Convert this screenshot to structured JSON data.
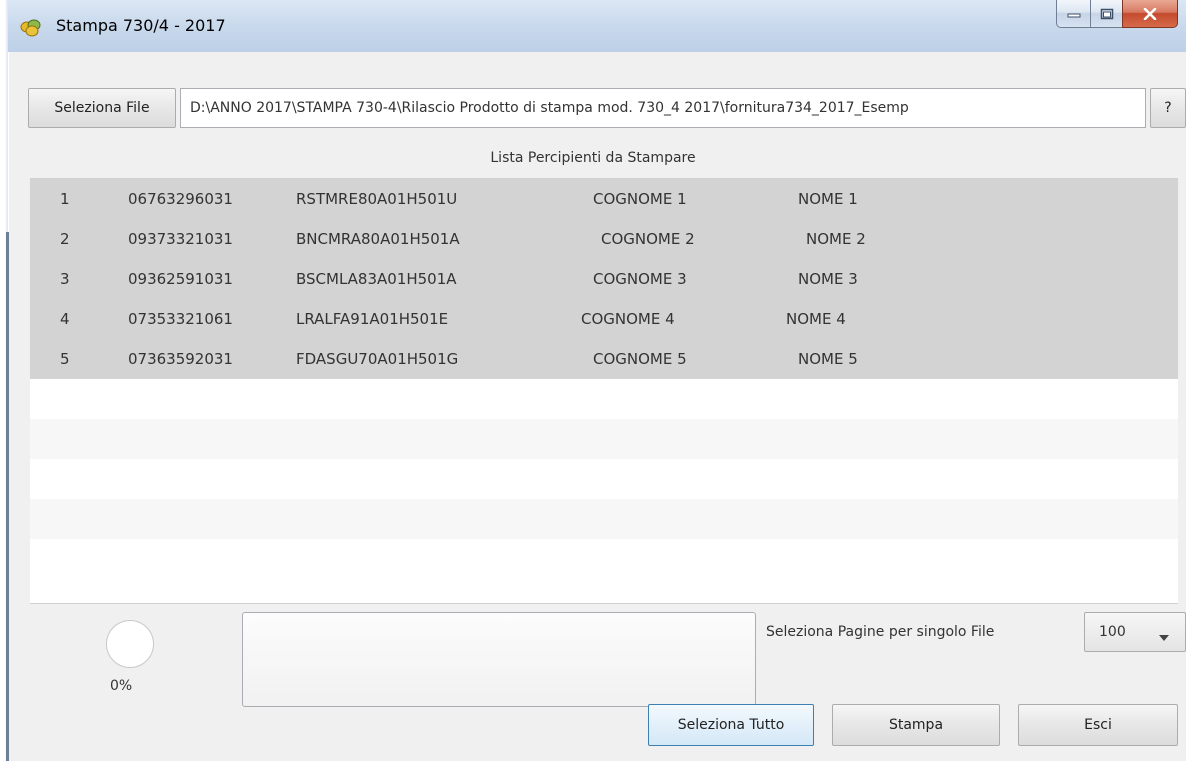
{
  "window": {
    "title": "Stampa 730/4 - 2017",
    "controls": [
      "minimize",
      "maximize",
      "close"
    ]
  },
  "file": {
    "select_button": "Seleziona File",
    "path": "D:\\ANNO 2017\\STAMPA  730-4\\Rilascio Prodotto di stampa mod. 730_4 2017\\fornitura734_2017_Esemp",
    "help_button": "?"
  },
  "list": {
    "title": "Lista Percipienti da Stampare",
    "rows": [
      {
        "index": "1",
        "code": "06763296031",
        "tax_id": "RSTMRE80A01H501U",
        "surname": "COGNOME 1",
        "name": "NOME 1"
      },
      {
        "index": "2",
        "code": "09373321031",
        "tax_id": "BNCMRA80A01H501A",
        "surname": "COGNOME 2",
        "name": "NOME 2"
      },
      {
        "index": "3",
        "code": "09362591031",
        "tax_id": "BSCMLA83A01H501A",
        "surname": "COGNOME 3",
        "name": "NOME 3"
      },
      {
        "index": "4",
        "code": "07353321061",
        "tax_id": "LRALFA91A01H501E",
        "surname": "COGNOME 4",
        "name": "NOME 4"
      },
      {
        "index": "5",
        "code": "07363592031",
        "tax_id": "FDASGU70A01H501G",
        "surname": "COGNOME 5",
        "name": "NOME 5"
      }
    ]
  },
  "progress": {
    "percent_label": "0%",
    "value": 0
  },
  "pages": {
    "label": "Seleziona Pagine per singolo File",
    "selected": "100"
  },
  "buttons": {
    "select_all": "Seleziona Tutto",
    "print": "Stampa",
    "exit": "Esci"
  },
  "colors": {
    "selected_row": "#d3d3d3",
    "titlebar": "#c9d9ec",
    "close_button": "#c54a2e"
  }
}
